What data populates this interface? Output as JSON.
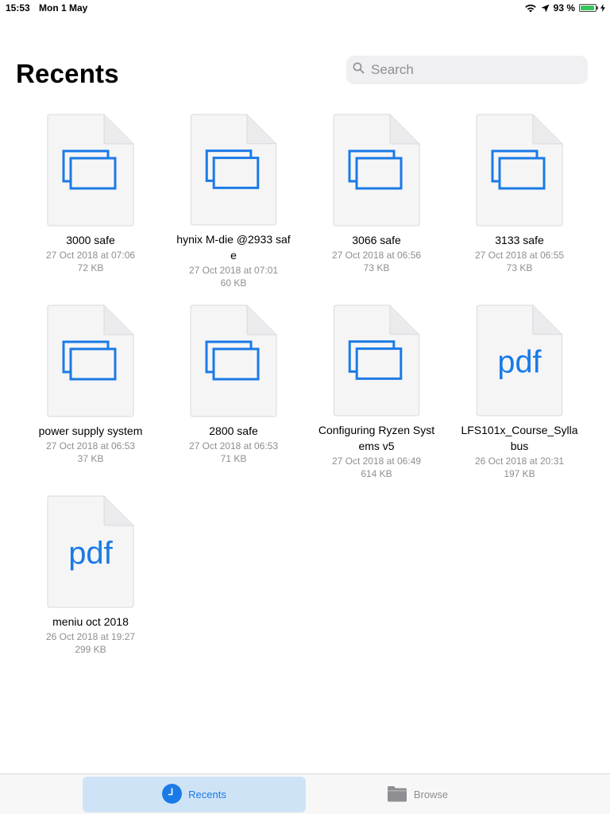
{
  "status_bar": {
    "time": "15:53",
    "date": "Mon 1 May",
    "battery_text": "93 %",
    "battery_level": 0.93
  },
  "header": {
    "title": "Recents",
    "search_placeholder": "Search"
  },
  "files": [
    {
      "name": "3000 safe",
      "date": "27 Oct 2018 at 07:06",
      "size": "72 KB",
      "type": "screens"
    },
    {
      "name": "hynix M-die @2933 safe",
      "date": "27 Oct 2018 at 07:01",
      "size": "60 KB",
      "type": "screens"
    },
    {
      "name": "3066 safe",
      "date": "27 Oct 2018 at 06:56",
      "size": "73 KB",
      "type": "screens"
    },
    {
      "name": "3133 safe",
      "date": "27 Oct 2018 at 06:55",
      "size": "73 KB",
      "type": "screens"
    },
    {
      "name": "power supply system",
      "date": "27 Oct 2018 at 06:53",
      "size": "37 KB",
      "type": "screens"
    },
    {
      "name": "2800 safe",
      "date": "27 Oct 2018 at 06:53",
      "size": "71 KB",
      "type": "screens"
    },
    {
      "name": "Configuring Ryzen Systems v5",
      "date": "27 Oct 2018 at 06:49",
      "size": "614 KB",
      "type": "screens"
    },
    {
      "name": "LFS101x_Course_Syllabus",
      "date": "26 Oct 2018 at 20:31",
      "size": "197 KB",
      "type": "pdf",
      "badge": "pdf"
    },
    {
      "name": "meniu oct 2018",
      "date": "26 Oct 2018 at 19:27",
      "size": "299 KB",
      "type": "pdf",
      "badge": "pdf"
    }
  ],
  "tab_bar": {
    "recents_label": "Recents",
    "browse_label": "Browse",
    "active_tab": "recents"
  },
  "colors": {
    "accent": "#1a7ae6",
    "thumb_bg": "#f5f5f6",
    "thumb_border": "#d9d9dc",
    "secondary_text": "#8e8e93"
  },
  "icons": {
    "wifi": "wifi-icon",
    "location": "location-arrow-icon",
    "battery": "battery-icon",
    "charging": "charging-bolt-icon",
    "search": "search-icon",
    "recents": "clock-icon",
    "browse": "folder-icon",
    "screens_doc": "screens-document-icon",
    "pdf_doc": "pdf-document-icon"
  }
}
